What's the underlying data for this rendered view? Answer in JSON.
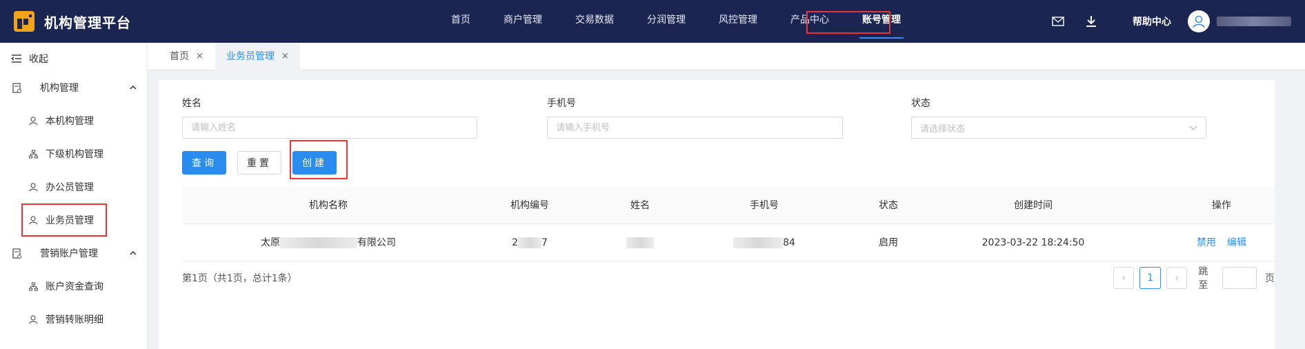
{
  "app": {
    "title": "机构管理平台"
  },
  "colors": {
    "header_bg": "#1b2552",
    "accent": "#2b8cf0",
    "highlight": "#e33333"
  },
  "nav": {
    "items": [
      {
        "label": "首页"
      },
      {
        "label": "商户管理"
      },
      {
        "label": "交易数据"
      },
      {
        "label": "分润管理"
      },
      {
        "label": "风控管理"
      },
      {
        "label": "产品中心"
      },
      {
        "label": "账号管理",
        "active": true
      }
    ]
  },
  "header_right": {
    "mail_icon": "mail-icon",
    "download_icon": "download-icon",
    "help_label": "帮助中心",
    "avatar_icon": "user-icon"
  },
  "sidebar": {
    "collapse_label": "收起",
    "groups": [
      {
        "label": "机构管理",
        "items": [
          {
            "label": "本机构管理"
          },
          {
            "label": "下级机构管理"
          },
          {
            "label": "办公员管理"
          },
          {
            "label": "业务员管理",
            "selected": true
          }
        ]
      },
      {
        "label": "营销账户管理",
        "items": [
          {
            "label": "账户资金查询"
          },
          {
            "label": "营销转账明细"
          }
        ]
      }
    ]
  },
  "tabs": [
    {
      "label": "首页",
      "close": "×"
    },
    {
      "label": "业务员管理",
      "close": "×",
      "active": true
    }
  ],
  "search": {
    "name_label": "姓名",
    "name_placeholder": "请输入姓名",
    "phone_label": "手机号",
    "phone_placeholder": "请输入手机号",
    "status_label": "状态",
    "status_placeholder": "请选择状态",
    "query_button": "查询",
    "reset_button": "重置",
    "create_button": "创建"
  },
  "table": {
    "columns": [
      "机构名称",
      "机构编号",
      "姓名",
      "手机号",
      "状态",
      "创建时间",
      "操作"
    ],
    "rows": [
      {
        "org_prefix": "太原",
        "org_suffix": "有限公司",
        "code_prefix": "2",
        "code_suffix": "7",
        "phone_suffix": "84",
        "status": "启用",
        "created": "2023-03-22 18:24:50",
        "actions": [
          "禁用",
          "编辑"
        ]
      }
    ]
  },
  "pagination": {
    "info": "第1页（共1页，总计1条）",
    "prev": "‹",
    "current": "1",
    "next": "›",
    "jump_label": "跳至",
    "page_suffix": "页"
  }
}
